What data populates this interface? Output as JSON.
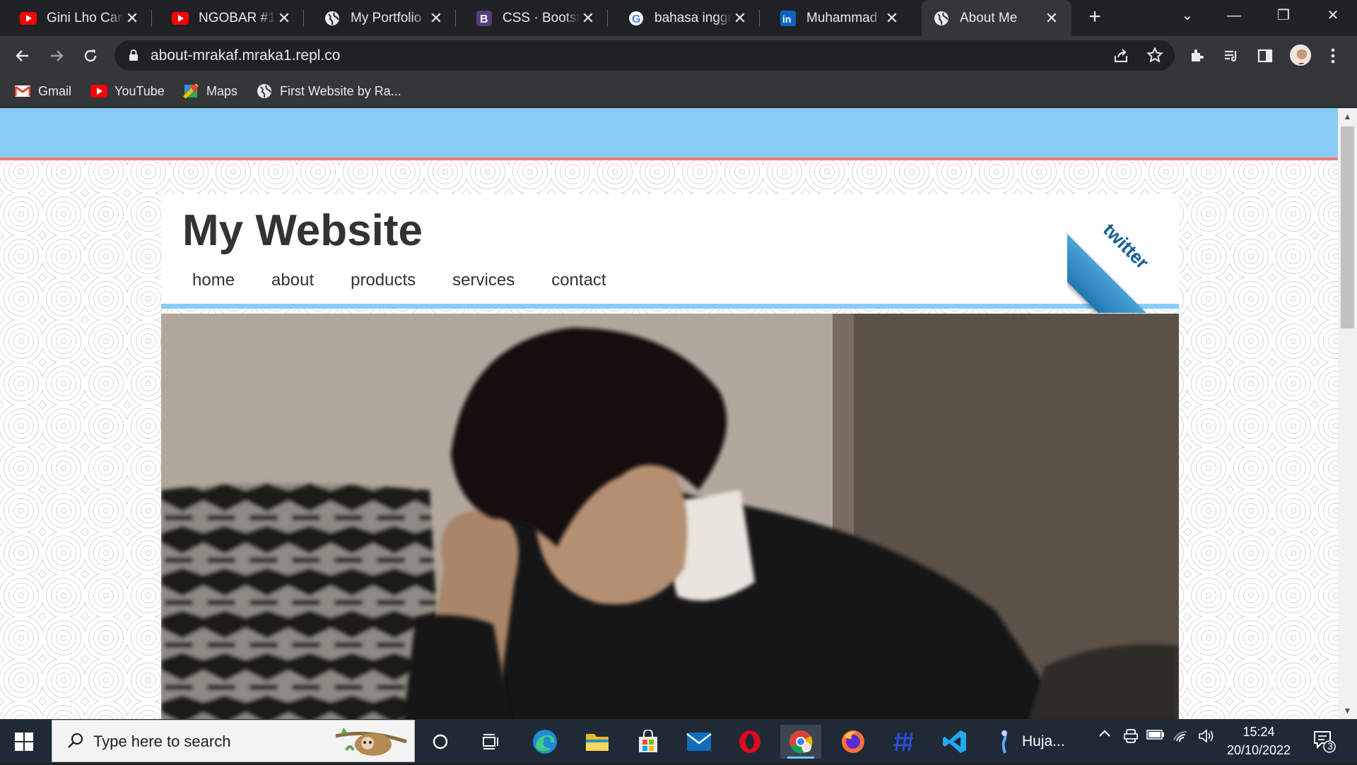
{
  "browser": {
    "tabs": [
      {
        "title": "Gini Lho Cara B",
        "icon": "youtube-icon"
      },
      {
        "title": "NGOBAR #1 : M",
        "icon": "youtube-icon"
      },
      {
        "title": "My Portfolio",
        "icon": "globe-icon"
      },
      {
        "title": "CSS · Bootstrap",
        "icon": "bootstrap-icon"
      },
      {
        "title": "bahasa inggris",
        "icon": "google-icon"
      },
      {
        "title": "Muhammad Ra",
        "icon": "linkedin-icon"
      },
      {
        "title": "About Me",
        "icon": "globe-icon"
      }
    ],
    "active_tab_index": 6,
    "url": "about-mrakaf.mraka1.repl.co",
    "bookmarks": [
      {
        "label": "Gmail",
        "icon": "gmail-icon"
      },
      {
        "label": "YouTube",
        "icon": "youtube-icon"
      },
      {
        "label": "Maps",
        "icon": "maps-icon"
      },
      {
        "label": "First Website by Ra...",
        "icon": "globe-icon"
      }
    ]
  },
  "page": {
    "site_title": "My Website",
    "nav": [
      "home",
      "about",
      "products",
      "services",
      "contact"
    ],
    "ribbon_text": "twitter",
    "colors": {
      "top_band": "#87cdf8",
      "accent_line": "#f3776e",
      "header_border": "#87cdf8"
    }
  },
  "taskbar": {
    "search_placeholder": "Type here to search",
    "running_app_label": "Huja...",
    "time": "15:24",
    "date": "20/10/2022",
    "notification_count": "3"
  }
}
